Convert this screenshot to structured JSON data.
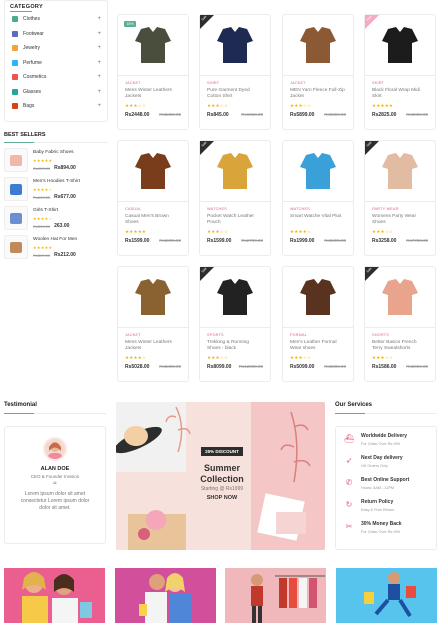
{
  "category": {
    "title": "CATEGORY",
    "items": [
      {
        "label": "Clothes",
        "icon": "dress-icon",
        "color": "#4dab8a"
      },
      {
        "label": "Footwear",
        "icon": "shoe-icon",
        "color": "#5c6bc0"
      },
      {
        "label": "Jewelry",
        "icon": "ring-icon",
        "color": "#f4a53a"
      },
      {
        "label": "Perfume",
        "icon": "perfume-icon",
        "color": "#29b6f6"
      },
      {
        "label": "Cosmetics",
        "icon": "cosmetics-icon",
        "color": "#ef5350"
      },
      {
        "label": "Glasses",
        "icon": "glasses-icon",
        "color": "#26a69a"
      },
      {
        "label": "Bags",
        "icon": "bag-icon",
        "color": "#d84315"
      }
    ],
    "expand_symbol": "+"
  },
  "best_sellers": {
    "title": "BEST SELLERS",
    "items": [
      {
        "name": "Baby Fabric Shoes",
        "rating": "★★★★★",
        "old": "Rs500.00",
        "new": "Rs894.00",
        "color": "#f4b6a9"
      },
      {
        "name": "Men's Hoodies T-Shirt",
        "rating": "★★★★☆",
        "old": "Rs800.00",
        "new": "Rs677.00",
        "color": "#3d7dd1"
      },
      {
        "name": "Girls T-Shirt",
        "rating": "★★★★☆",
        "old": "Rs300.00",
        "new": "263.00",
        "color": "#6b8fcf"
      },
      {
        "name": "Woolen Hat For Men",
        "rating": "★★★★★",
        "old": "Rs500.00",
        "new": "Rs212.00",
        "color": "#c08a5b"
      }
    ]
  },
  "products": [
    {
      "cat": "JACKET",
      "name": "Mens Winter Leathers Jackets",
      "rating": "★★★☆☆",
      "price": "Rs2448.00",
      "old": "Rs5800.00",
      "badge": "15%",
      "badge_type": "green",
      "color": "#4a4e3d"
    },
    {
      "cat": "SHIRT",
      "name": "Pure Garment Dyed Cotton Shirt",
      "rating": "★★★☆☆",
      "price": "Rs845.00",
      "old": "Rs1950.00",
      "badge": "Sale",
      "badge_type": "dark",
      "color": "#1f2a52"
    },
    {
      "cat": "JACKET",
      "name": "MEN Yarn Fleece Full-Zip Jacket",
      "rating": "★★★☆☆",
      "price": "Rs5899.00",
      "old": "Rs8899.00",
      "badge": "",
      "badge_type": "",
      "color": "#8b5a35"
    },
    {
      "cat": "SKIRT",
      "name": "Black Floral Wrap Midi Skirt",
      "rating": "★★★★★",
      "price": "Rs2825.00",
      "old": "Rs3899.00",
      "badge": "New",
      "badge_type": "pink",
      "color": "#1c1c1c"
    },
    {
      "cat": "CASUAL",
      "name": "Casual Men's Brown Shoes",
      "rating": "★★★★★",
      "price": "Rs1599.00",
      "old": "Rs2899.00",
      "badge": "",
      "badge_type": "",
      "color": "#7a3d1c"
    },
    {
      "cat": "WATCHES",
      "name": "Pocket Watch Leather Pouch",
      "rating": "★★★☆☆",
      "price": "Rs1599.00",
      "old": "Rs2799.00",
      "badge": "Sale",
      "badge_type": "dark",
      "color": "#d9a43a"
    },
    {
      "cat": "WATCHES",
      "name": "Smart Watche Vital Plus",
      "rating": "★★★★☆",
      "price": "Rs1999.00",
      "old": "Rs5899.00",
      "badge": "",
      "badge_type": "",
      "color": "#3aa0d8"
    },
    {
      "cat": "PARTY WEAR",
      "name": "Womens Party Wear Shoes",
      "rating": "★★★☆☆",
      "price": "Rs3258.00",
      "old": "Rs7758.00",
      "badge": "Sale",
      "badge_type": "dark",
      "color": "#e2bba3"
    },
    {
      "cat": "JACKET",
      "name": "Mens Winter Leathers Jackets",
      "rating": "★★★★☆",
      "price": "Rs5028.00",
      "old": "Rs5800.00",
      "badge": "",
      "badge_type": "",
      "color": "#8a6232"
    },
    {
      "cat": "SPORTS",
      "name": "Trekking & Running Shoes - black",
      "rating": "★★★☆☆",
      "price": "Rs8099.00",
      "old": "Rs12000.00",
      "badge": "Sale",
      "badge_type": "dark",
      "color": "#222222"
    },
    {
      "cat": "FORMAL",
      "name": "Men's Leather Formal Wear shoes",
      "rating": "★★★☆☆",
      "price": "Rs5099.00",
      "old": "Rs8899.00",
      "badge": "",
      "badge_type": "",
      "color": "#5a3220"
    },
    {
      "cat": "SHORTS",
      "name": "Better Basics French Terry Sweatshorts",
      "rating": "★★★☆☆",
      "price": "Rs1586.00",
      "old": "Rs2099.00",
      "badge": "Sale",
      "badge_type": "dark",
      "color": "#e8a48c"
    }
  ],
  "testimonial": {
    "title": "Testimonial",
    "name": "ALAN DOE",
    "role": "CEO & Founder Invision",
    "quote_mark": "“",
    "text": "Lorem ipsum dolor sit amet consectetur Lorem ipsum dolor dolor sit amet."
  },
  "banner": {
    "discount": "25% DISCOUNT",
    "title": "Summer Collection",
    "subtitle": "Starting @ Rs1999",
    "cta": "SHOP NOW"
  },
  "services": {
    "title": "Our Services",
    "items": [
      {
        "title": "Worldwide Delivery",
        "sub": "For Order Over Rs.999",
        "icon": "ship-icon"
      },
      {
        "title": "Next Day delivery",
        "sub": "UK Orders Only",
        "icon": "rocket-icon"
      },
      {
        "title": "Best Online Support",
        "sub": "Hours: 8AM - 11PM",
        "icon": "phone-icon"
      },
      {
        "title": "Return Policy",
        "sub": "Easy & Free Return",
        "icon": "return-icon"
      },
      {
        "title": "30% Money Back",
        "sub": "For Order Over Rs.999",
        "icon": "ticket-icon"
      }
    ]
  },
  "accent": "#e0607e",
  "brand_green": "#5caf90"
}
